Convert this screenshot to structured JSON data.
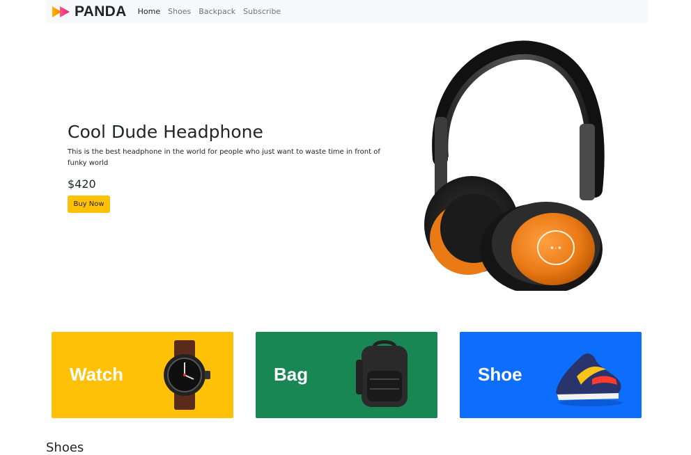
{
  "brand": {
    "name": "PANDA",
    "logo_icon": "panda-play-logo-icon"
  },
  "nav": {
    "items": [
      {
        "label": "Home",
        "active": true
      },
      {
        "label": "Shoes",
        "active": false
      },
      {
        "label": "Backpack",
        "active": false
      },
      {
        "label": "Subscribe",
        "active": false
      }
    ]
  },
  "hero": {
    "title": "Cool Dude Headphone",
    "description": "This is the best headphone in the world for people who just want to waste time in front of funky world",
    "price": "$420",
    "button_label": "Buy Now",
    "image": "headphone-image"
  },
  "categories": [
    {
      "label": "Watch",
      "color": "#ffc107",
      "image": "watch-image"
    },
    {
      "label": "Bag",
      "color": "#198754",
      "image": "backpack-image"
    },
    {
      "label": "Shoe",
      "color": "#0d6efd",
      "image": "sneaker-image"
    }
  ],
  "sections": {
    "shoes_title": "Shoes"
  },
  "colors": {
    "navbar_bg": "#f8f9fa",
    "accent": "#ffc107",
    "headphone_orange": "#ea7a15"
  }
}
